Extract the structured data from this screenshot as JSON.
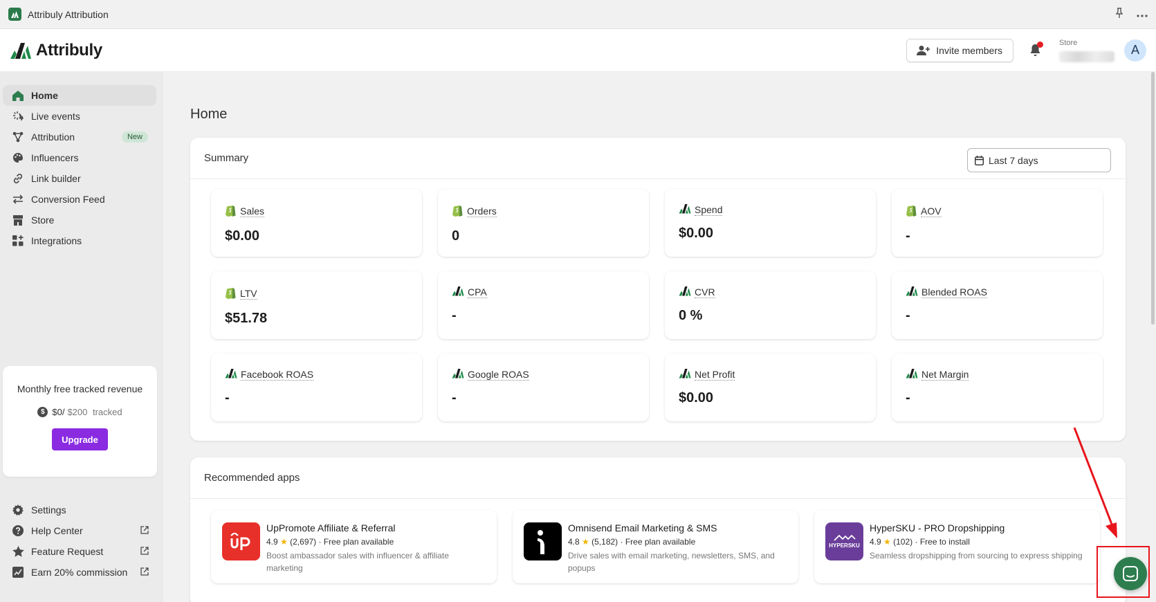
{
  "window": {
    "title": "Attribuly Attribution"
  },
  "header": {
    "brand": "Attribuly",
    "invite_label": "Invite members",
    "store_label": "Store",
    "avatar_initial": "A"
  },
  "sidebar": {
    "items": [
      {
        "label": "Home",
        "icon": "home-icon"
      },
      {
        "label": "Live events",
        "icon": "sparkle-icon"
      },
      {
        "label": "Attribution",
        "icon": "attribution-icon",
        "badge": "New"
      },
      {
        "label": "Influencers",
        "icon": "palette-icon"
      },
      {
        "label": "Link builder",
        "icon": "link-icon"
      },
      {
        "label": "Conversion Feed",
        "icon": "arrows-icon"
      },
      {
        "label": "Store",
        "icon": "store-icon"
      },
      {
        "label": "Integrations",
        "icon": "apps-icon"
      }
    ],
    "quota": {
      "title": "Monthly free tracked revenue",
      "used": "$0/",
      "limit": "$200",
      "suffix": " tracked",
      "upgrade_label": "Upgrade"
    },
    "bottom_items": [
      {
        "label": "Settings",
        "icon": "gear-icon"
      },
      {
        "label": "Help Center",
        "icon": "help-icon"
      },
      {
        "label": "Feature Request",
        "icon": "star-icon"
      },
      {
        "label": "Earn 20% commission",
        "icon": "commission-icon"
      }
    ]
  },
  "main": {
    "page_title": "Home",
    "summary": {
      "title": "Summary",
      "date_range": "Last 7 days",
      "metrics": [
        {
          "label": "Sales",
          "value": "$0.00",
          "source": "shopify"
        },
        {
          "label": "Orders",
          "value": "0",
          "source": "shopify"
        },
        {
          "label": "Spend",
          "value": "$0.00",
          "source": "attribuly"
        },
        {
          "label": "AOV",
          "value": "-",
          "source": "shopify"
        },
        {
          "label": "LTV",
          "value": "$51.78",
          "source": "shopify"
        },
        {
          "label": "CPA",
          "value": "-",
          "source": "attribuly"
        },
        {
          "label": "CVR",
          "value": "0 %",
          "source": "attribuly"
        },
        {
          "label": "Blended ROAS",
          "value": "-",
          "source": "attribuly"
        },
        {
          "label": "Facebook ROAS",
          "value": "-",
          "source": "attribuly"
        },
        {
          "label": "Google ROAS",
          "value": "-",
          "source": "attribuly"
        },
        {
          "label": "Net Profit",
          "value": "$0.00",
          "source": "attribuly"
        },
        {
          "label": "Net Margin",
          "value": "-",
          "source": "attribuly"
        }
      ]
    },
    "recommended": {
      "title": "Recommended apps",
      "apps": [
        {
          "name": "UpPromote Affiliate & Referral",
          "rating": "4.9",
          "reviews": "(2,697)",
          "plan": "Free plan available",
          "desc": "Boost ambassador sales with influencer & affiliate marketing",
          "color": "#e8302a"
        },
        {
          "name": "Omnisend Email Marketing & SMS",
          "rating": "4.8",
          "reviews": "(5,182)",
          "plan": "Free plan available",
          "desc": "Drive sales with email marketing, newsletters, SMS, and popups",
          "color": "#000000"
        },
        {
          "name": "HyperSKU - PRO Dropshipping",
          "rating": "4.9",
          "reviews": "(102)",
          "plan": "Free to install",
          "desc": "Seamless dropshipping from sourcing to express shipping",
          "logo_text": "HYPERSKU",
          "color": "#6a3d9a"
        }
      ]
    }
  },
  "colors": {
    "brand_green": "#2e7d4f",
    "upgrade_purple": "#8a2be2",
    "annotation_red": "#e8141c"
  }
}
